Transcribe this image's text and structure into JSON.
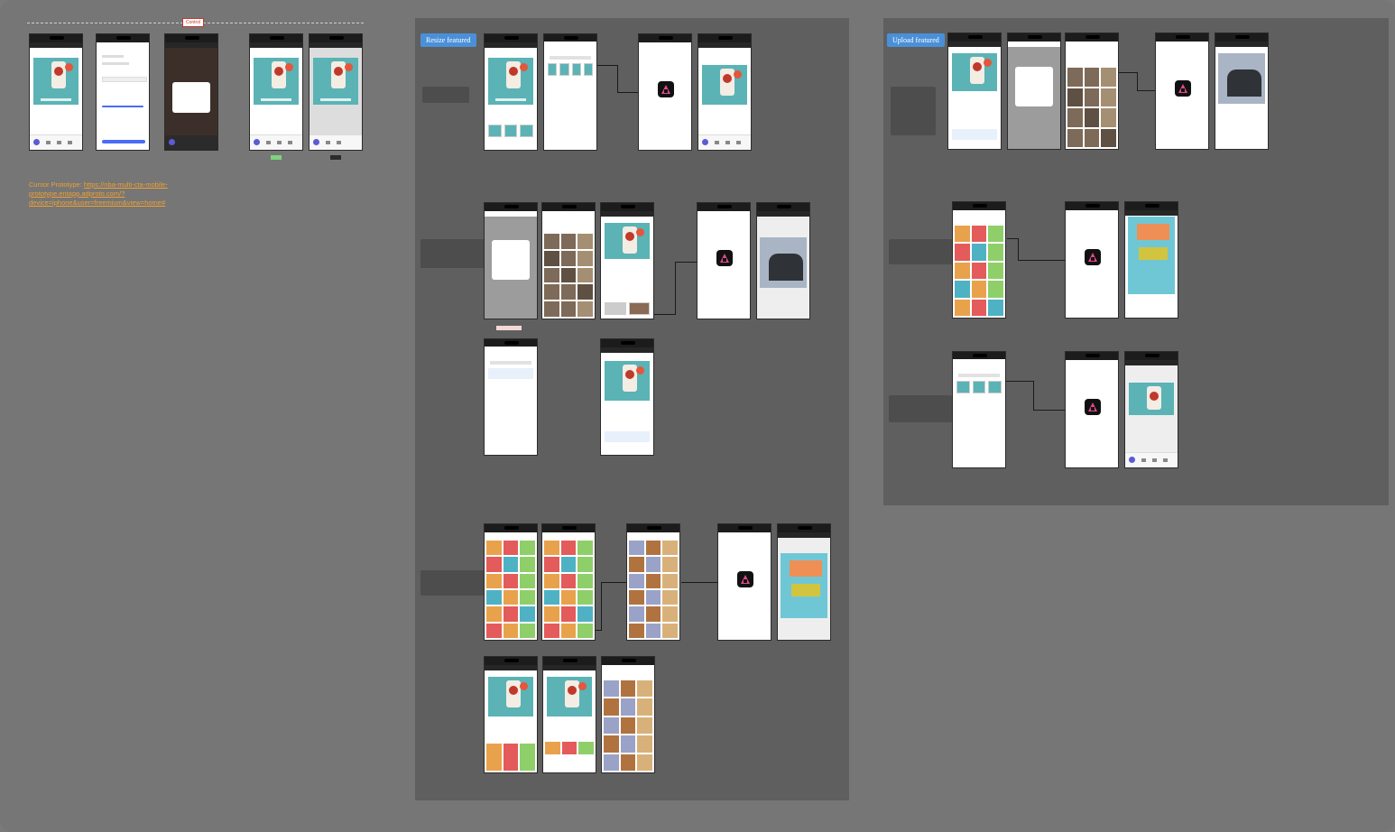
{
  "control_tag": "Control",
  "prototype_link": {
    "prefix": "Cursor Prototype: ",
    "url": "https://nba-multi-cta-mobile-prototype.entapp.adproto.com/?device=iphone&user=freemium&view=home#"
  },
  "sections": [
    {
      "label": "Resize featured"
    },
    {
      "label": "Upload featured"
    }
  ],
  "colors": {
    "canvas": "#767676",
    "section": "#5f5f5f",
    "label_bg": "#4a90d9",
    "link": "#f0a030",
    "art_teal": "#5bb3b5"
  },
  "icons": [
    "adobe-express-logo-icon"
  ]
}
